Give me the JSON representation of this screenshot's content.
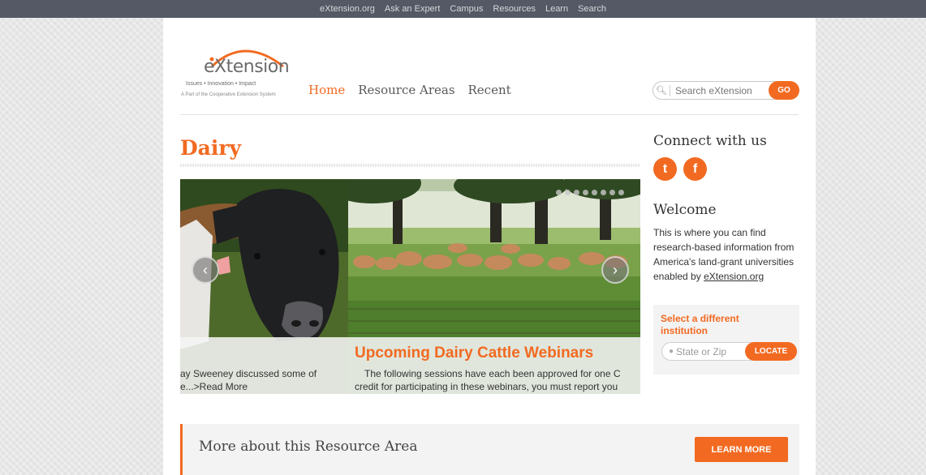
{
  "topnav": {
    "links": [
      "eXtension.org",
      "Ask an Expert",
      "Campus",
      "Resources",
      "Learn",
      "Search"
    ]
  },
  "logo": {
    "wordmark": "eXtension",
    "tagline": "Issues • Innovation • Impact",
    "subline": "A Part of the Cooperative Extension System"
  },
  "mainnav": {
    "items": [
      "Home",
      "Resource Areas",
      "Recent"
    ],
    "active": "Home"
  },
  "search": {
    "placeholder": "Search eXtension",
    "button_label": "GO"
  },
  "page": {
    "title": "Dairy"
  },
  "carousel": {
    "slide_headline": "Upcoming Dairy Cattle Webinars",
    "slide_text_line1": "The following sessions have each been approved for one C",
    "slide_text_line2": "credit for participating in these webinars, you must report you",
    "prev_text_line1": "ay Sweeney discussed some of",
    "prev_text_line2": "e...>Read More",
    "prev_arrow": "‹",
    "next_arrow": "›",
    "dot_count": 8
  },
  "sidebar": {
    "connect_title": "Connect with us",
    "social": [
      {
        "name": "twitter-icon",
        "glyph": "t"
      },
      {
        "name": "facebook-icon",
        "glyph": "f"
      }
    ],
    "welcome_title": "Welcome",
    "welcome_text": "This is where you can find research-based information from America's land-grant universities enabled by",
    "welcome_link": "eXtension.org",
    "locate_title": "Select a different institution",
    "locate_placeholder": "State or Zip",
    "locate_button": "LOCATE"
  },
  "bottom": {
    "more_title": "More about this Resource Area",
    "learn_more": "LEARN MORE"
  },
  "colors": {
    "accent": "#f26a21",
    "topbar": "#545965"
  }
}
